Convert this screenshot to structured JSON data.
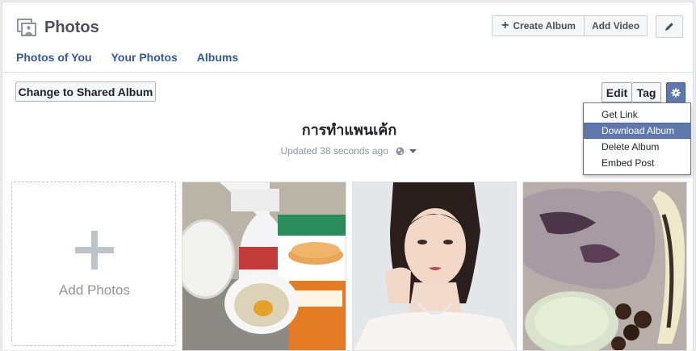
{
  "header": {
    "title": "Photos",
    "create_album": "Create Album",
    "add_video": "Add Video"
  },
  "tabs": [
    {
      "label": "Photos of You"
    },
    {
      "label": "Your Photos"
    },
    {
      "label": "Albums"
    }
  ],
  "toolbar": {
    "shared_album": "Change to Shared Album",
    "edit": "Edit",
    "tag": "Tag"
  },
  "album": {
    "title": "การทำแพนเค้ก",
    "updated": "Updated 38 seconds ago"
  },
  "menu": {
    "items": [
      {
        "label": "Get Link"
      },
      {
        "label": "Download Album"
      },
      {
        "label": "Delete Album"
      },
      {
        "label": "Embed Post"
      }
    ],
    "active_index": 1
  },
  "grid": {
    "add_label": "Add Photos",
    "photos": [
      {
        "subject": "pancake ingredients: milk bottle, egg in bowl, pancake mix box"
      },
      {
        "subject": "portrait of woman in white dress"
      },
      {
        "subject": "pancake with sauce and banana"
      }
    ]
  }
}
